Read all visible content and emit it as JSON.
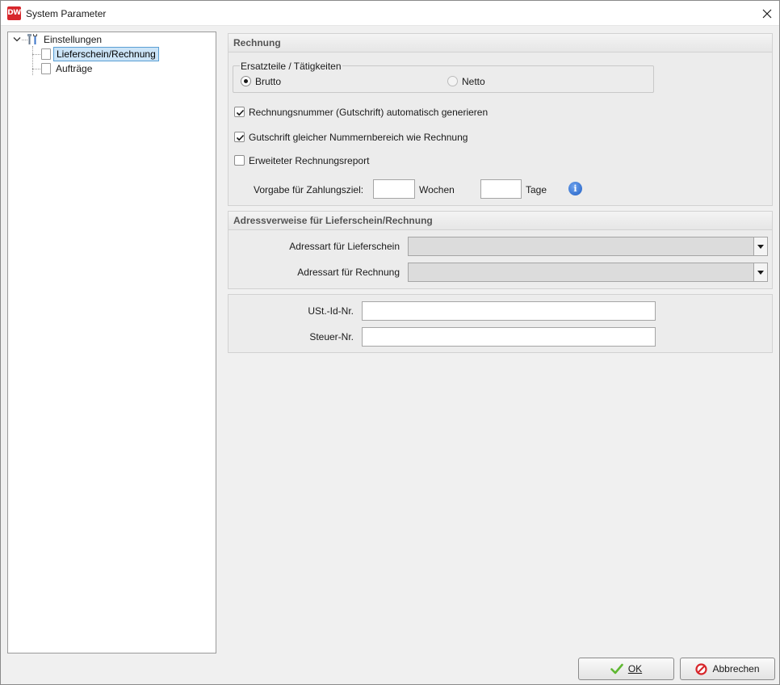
{
  "window": {
    "app_icon_text": "DW",
    "title": "System Parameter"
  },
  "tree": {
    "root": {
      "label": "Einstellungen",
      "expanded": true
    },
    "children": [
      {
        "label": "Lieferschein/Rechnung",
        "selected": true
      },
      {
        "label": "Aufträge",
        "selected": false
      }
    ]
  },
  "rechnung": {
    "header": "Rechnung",
    "ersatzteile_legend": "Ersatzteile / Tätigkeiten",
    "radio_brutto": {
      "label": "Brutto",
      "checked": true
    },
    "radio_netto": {
      "label": "Netto",
      "checked": false
    },
    "cb_rechnungsnummer": {
      "label": "Rechnungsnummer (Gutschrift) automatisch generieren",
      "checked": true
    },
    "cb_gutschrift": {
      "label": "Gutschrift gleicher Nummernbereich wie Rechnung",
      "checked": true
    },
    "cb_erweiterter": {
      "label": "Erweiteter Rechnungsreport",
      "checked": false
    },
    "zahlungsziel_label": "Vorgabe für Zahlungsziel:",
    "wochen_value": "",
    "wochen_label": "Wochen",
    "tage_value": "",
    "tage_label": "Tage"
  },
  "adress": {
    "header": "Adressverweise für Lieferschein/Rechnung",
    "lieferschein_label": "Adressart für Lieferschein",
    "lieferschein_value": "",
    "rechnung_label": "Adressart für Rechnung",
    "rechnung_value": ""
  },
  "steuer": {
    "ust_label": "USt.-Id-Nr.",
    "ust_value": "",
    "steuer_label": "Steuer-Nr.",
    "steuer_value": ""
  },
  "buttons": {
    "ok_label": "OK",
    "cancel_label": "Abbrechen"
  },
  "colors": {
    "app_icon": "#d7262b",
    "selection_bg": "#cce4f7",
    "info_icon": "#2160c4",
    "ok_check": "#5fb832",
    "cancel_icon": "#d7262b"
  }
}
